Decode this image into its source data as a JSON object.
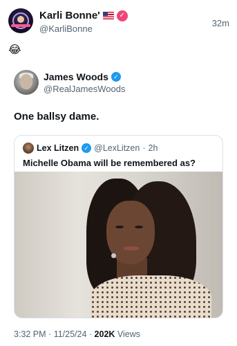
{
  "outer_tweet": {
    "display_name": "Karli Bonne'",
    "handle": "@KarliBonne",
    "time": "32m",
    "flag_icon": "us-flag-icon",
    "badge_icon": "verified-badge-pink-icon",
    "badge_color": "#f0457c",
    "text": "😂"
  },
  "quoted_tweet": {
    "display_name": "James Woods",
    "handle": "@RealJamesWoods",
    "badge_color": "#1d9bf0",
    "text": "One ballsy dame.",
    "footer": {
      "time": "3:32 PM",
      "date": "11/25/24",
      "views_count": "202K",
      "views_label": "Views"
    }
  },
  "inner_tweet": {
    "display_name": "Lex Litzen",
    "handle": "@LexLitzen",
    "time": "2h",
    "text": "Michelle Obama will be remembered as?"
  }
}
